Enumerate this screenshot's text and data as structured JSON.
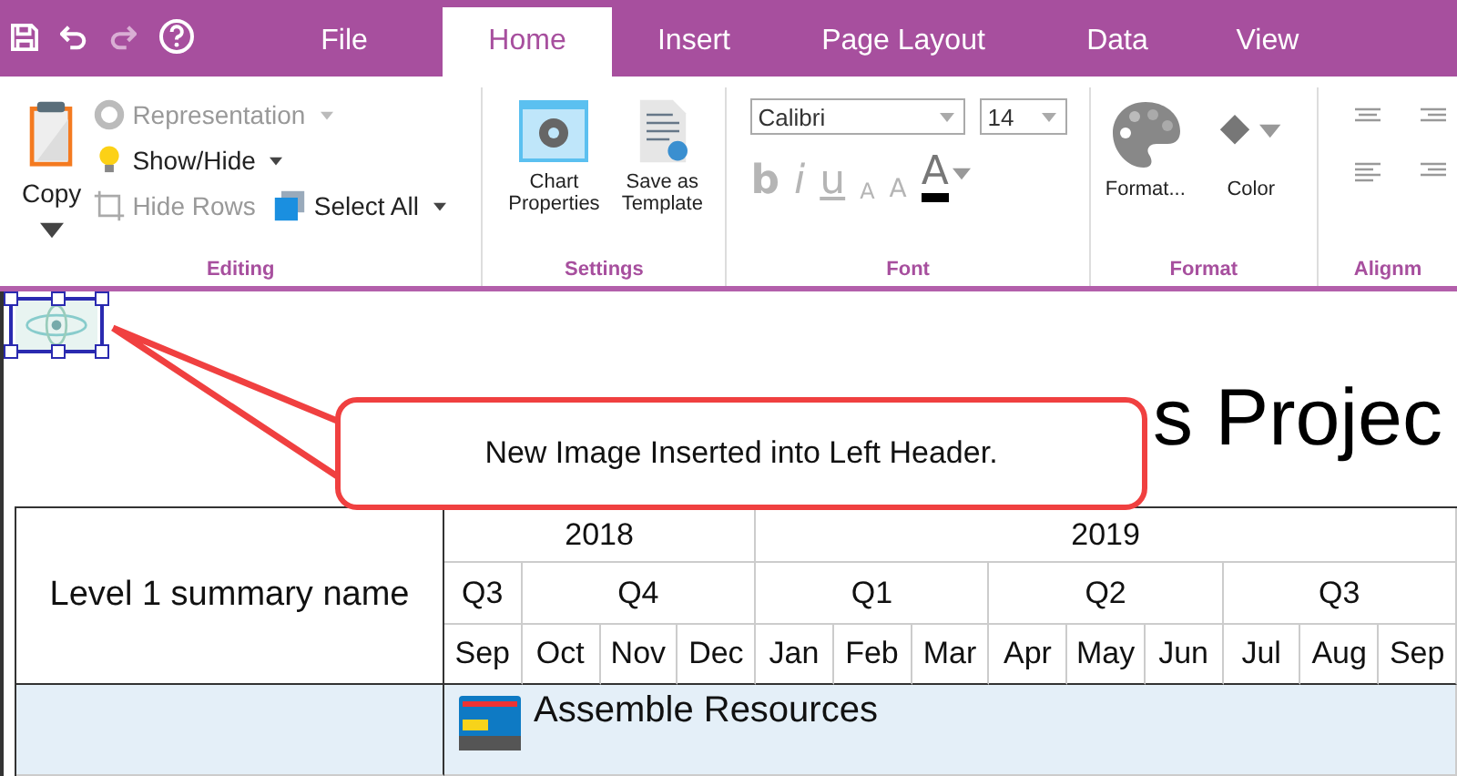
{
  "quick_access": [
    {
      "kind": "save",
      "disabled": false
    },
    {
      "kind": "undo",
      "disabled": false
    },
    {
      "kind": "redo",
      "disabled": true
    },
    {
      "kind": "help",
      "disabled": false
    }
  ],
  "tabs": [
    {
      "label": "File",
      "selected": false
    },
    {
      "label": "Home",
      "selected": true
    },
    {
      "label": "Insert",
      "selected": false
    },
    {
      "label": "Page Layout",
      "selected": false
    },
    {
      "label": "Data",
      "selected": false
    },
    {
      "label": "View",
      "selected": false
    }
  ],
  "ribbon": {
    "editing": {
      "label": "Editing",
      "copy": {
        "label": "Copy"
      },
      "representation": {
        "label": "Representation",
        "disabled": true
      },
      "show_hide": {
        "label": "Show/Hide",
        "disabled": false
      },
      "hide_rows": {
        "label": "Hide Rows",
        "disabled": true
      },
      "select_all": {
        "label": "Select All",
        "disabled": false
      }
    },
    "settings": {
      "label": "Settings",
      "chart_properties": [
        "Chart",
        "Properties"
      ],
      "save_template": [
        "Save as",
        "Template"
      ]
    },
    "font": {
      "label": "Font",
      "family": "Calibri",
      "size": "14",
      "buttons": [
        {
          "label": "b",
          "kind": "bold",
          "disabled": true
        },
        {
          "label": "i",
          "kind": "italic",
          "disabled": true
        },
        {
          "label": "u",
          "kind": "underline",
          "disabled": true
        },
        {
          "label": "A",
          "kind": "shrink",
          "disabled": true
        },
        {
          "label": "A",
          "kind": "grow",
          "disabled": true
        },
        {
          "label": "A",
          "kind": "color",
          "disabled": false
        }
      ]
    },
    "format": {
      "label": "Format",
      "format_button": "Format...",
      "color_button": "Color"
    },
    "alignment": {
      "label": "Alignm"
    }
  },
  "page": {
    "title": "s Projec",
    "callout": "New Image Inserted into Left Header.",
    "header_image": {
      "selected": true
    }
  },
  "table": {
    "name_header": "Level 1 summary name",
    "years": [
      {
        "label": "2018",
        "quarters": [
          {
            "label": "Q3",
            "months": [
              "Sep"
            ]
          },
          {
            "label": "Q4",
            "months": [
              "Oct",
              "Nov",
              "Dec"
            ]
          }
        ]
      },
      {
        "label": "2019",
        "quarters": [
          {
            "label": "Q1",
            "months": [
              "Jan",
              "Feb",
              "Mar"
            ]
          },
          {
            "label": "Q2",
            "months": [
              "Apr",
              "May",
              "Jun"
            ]
          },
          {
            "label": "Q3",
            "months": [
              "Jul",
              "Aug",
              "Sep"
            ]
          }
        ]
      }
    ],
    "rows": [
      {
        "name": "Assemble Resources"
      }
    ]
  }
}
